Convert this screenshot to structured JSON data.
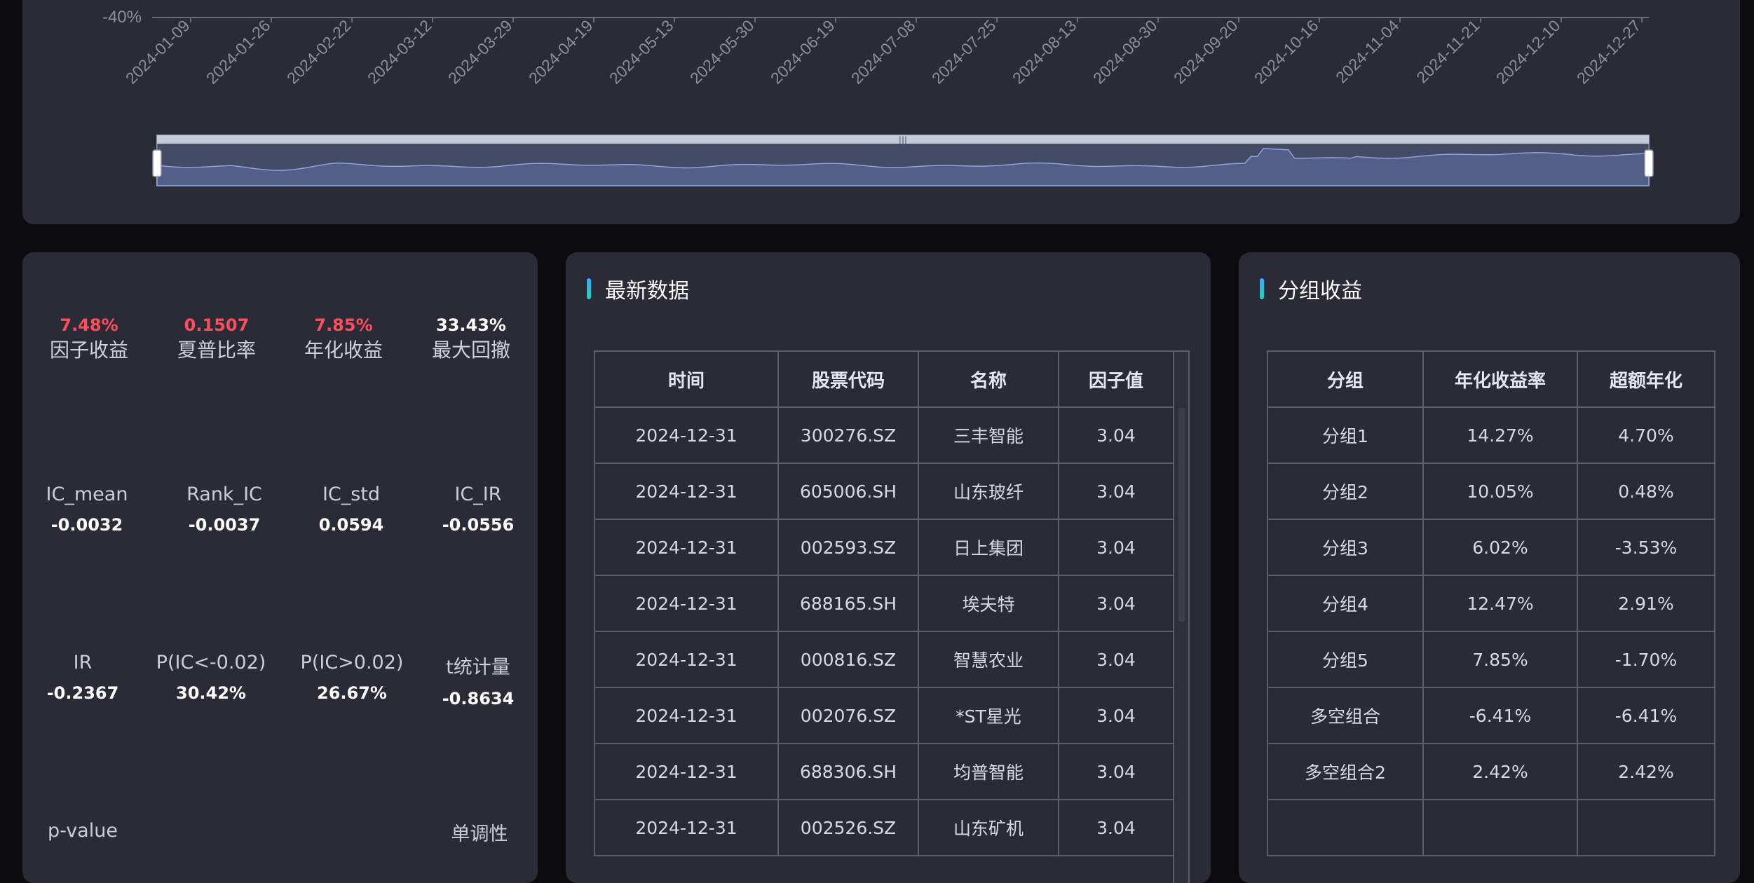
{
  "chart": {
    "y_tick_label": "-40%",
    "x_ticks": [
      "2024-01-09",
      "2024-01-26",
      "2024-02-22",
      "2024-03-12",
      "2024-03-29",
      "2024-04-19",
      "2024-05-13",
      "2024-05-30",
      "2024-06-19",
      "2024-07-08",
      "2024-07-25",
      "2024-08-13",
      "2024-08-30",
      "2024-09-20",
      "2024-10-16",
      "2024-11-04",
      "2024-11-21",
      "2024-12-10",
      "2024-12-27"
    ],
    "zoom_start_pct": 0,
    "zoom_end_pct": 100
  },
  "metrics": {
    "row1": [
      {
        "value": "7.48%",
        "label": "因子收益",
        "highlight": true
      },
      {
        "value": "0.1507",
        "label": "夏普比率",
        "highlight": true
      },
      {
        "value": "7.85%",
        "label": "年化收益",
        "highlight": true
      },
      {
        "value": "33.43%",
        "label": "最大回撤",
        "highlight": false
      }
    ],
    "row2": [
      {
        "label": "IC_mean",
        "value": "-0.0032"
      },
      {
        "label": "Rank_IC",
        "value": "-0.0037"
      },
      {
        "label": "IC_std",
        "value": "0.0594"
      },
      {
        "label": "IC_IR",
        "value": "-0.0556"
      }
    ],
    "row3": [
      {
        "label": "IR",
        "value": "-0.2367"
      },
      {
        "label": "P(IC<-0.02)",
        "value": "30.42%"
      },
      {
        "label": "P(IC>0.02)",
        "value": "26.67%"
      },
      {
        "label": "t统计量",
        "value": "-0.8634"
      }
    ],
    "row4": [
      {
        "label": "p-value"
      },
      {
        "label": "单调性"
      }
    ]
  },
  "latest": {
    "title": "最新数据",
    "headers": [
      "时间",
      "股票代码",
      "名称",
      "因子值"
    ],
    "rows": [
      [
        "2024-12-31",
        "300276.SZ",
        "三丰智能",
        "3.04"
      ],
      [
        "2024-12-31",
        "605006.SH",
        "山东玻纤",
        "3.04"
      ],
      [
        "2024-12-31",
        "002593.SZ",
        "日上集团",
        "3.04"
      ],
      [
        "2024-12-31",
        "688165.SH",
        "埃夫特",
        "3.04"
      ],
      [
        "2024-12-31",
        "000816.SZ",
        "智慧农业",
        "3.04"
      ],
      [
        "2024-12-31",
        "002076.SZ",
        "*ST星光",
        "3.04"
      ],
      [
        "2024-12-31",
        "688306.SH",
        "均普智能",
        "3.04"
      ],
      [
        "2024-12-31",
        "002526.SZ",
        "山东矿机",
        "3.04"
      ]
    ]
  },
  "groups": {
    "title": "分组收益",
    "headers": [
      "分组",
      "年化收益率",
      "超额年化"
    ],
    "rows": [
      [
        "分组1",
        "14.27%",
        "4.70%"
      ],
      [
        "分组2",
        "10.05%",
        "0.48%"
      ],
      [
        "分组3",
        "6.02%",
        "-3.53%"
      ],
      [
        "分组4",
        "12.47%",
        "2.91%"
      ],
      [
        "分组5",
        "7.85%",
        "-1.70%"
      ],
      [
        "多空组合",
        "-6.41%",
        "-6.41%"
      ],
      [
        "多空组合2",
        "2.42%",
        "2.42%"
      ],
      [
        "",
        "",
        ""
      ]
    ]
  },
  "colors": {
    "panel_bg": "#2a2b36",
    "highlight_red": "#ff4d5a",
    "title_accent": "#36a7ff"
  }
}
